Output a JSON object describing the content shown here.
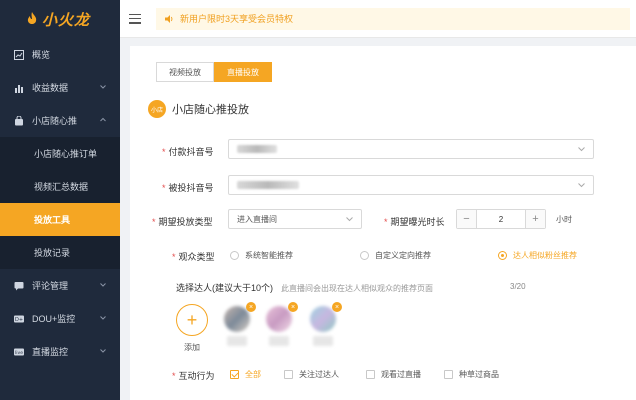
{
  "brand": {
    "logo_text": "小火龙",
    "accent": "#f5a623"
  },
  "sidebar": {
    "items": [
      {
        "label": "概览",
        "icon": "chart-line-icon",
        "has_children": false
      },
      {
        "label": "收益数据",
        "icon": "bar-chart-icon",
        "has_children": true
      },
      {
        "label": "小店随心推",
        "icon": "shop-bag-icon",
        "has_children": true,
        "expanded": true
      }
    ],
    "sub_items": [
      {
        "label": "小店随心推订单",
        "active": false
      },
      {
        "label": "视频汇总数据",
        "active": false
      },
      {
        "label": "投放工具",
        "active": true
      },
      {
        "label": "投放记录",
        "active": false
      }
    ],
    "items_after": [
      {
        "label": "评论管理",
        "icon": "comment-icon",
        "has_children": true
      },
      {
        "label": "DOU+监控",
        "icon": "dou-icon",
        "has_children": true
      },
      {
        "label": "直播监控",
        "icon": "live-icon",
        "has_children": true
      }
    ]
  },
  "topbar": {
    "notice": "新用户限时3天享受会员特权"
  },
  "main": {
    "tabs": [
      {
        "label": "视频投放",
        "active": false
      },
      {
        "label": "直播投放",
        "active": true
      }
    ],
    "section_badge": "小店",
    "section_title": "小店随心推投放",
    "pay_account_label": "付款抖音号",
    "target_account_label": "被投抖音号",
    "goal_type_label": "期望投放类型",
    "goal_type_value": "进入直播间",
    "exposure_label": "期望曝光时长",
    "exposure_value": "2",
    "exposure_unit": "小时",
    "audience_label": "观众类型",
    "audience_options": [
      {
        "label": "系统智能推荐",
        "checked": false
      },
      {
        "label": "自定义定向推荐",
        "checked": false
      },
      {
        "label": "达人相似粉丝推荐",
        "checked": true
      }
    ],
    "talent_title": "选择达人(建议大于10个)",
    "talent_hint": "此直播间会出现在达人相似观众的推荐页面",
    "talent_count": "3/20",
    "add_label": "添加",
    "interaction_label": "互动行为",
    "interaction_options": [
      {
        "label": "全部",
        "checked": true
      },
      {
        "label": "关注过达人",
        "checked": false
      },
      {
        "label": "观看过直播",
        "checked": false
      },
      {
        "label": "种草过商品",
        "checked": false
      }
    ]
  }
}
